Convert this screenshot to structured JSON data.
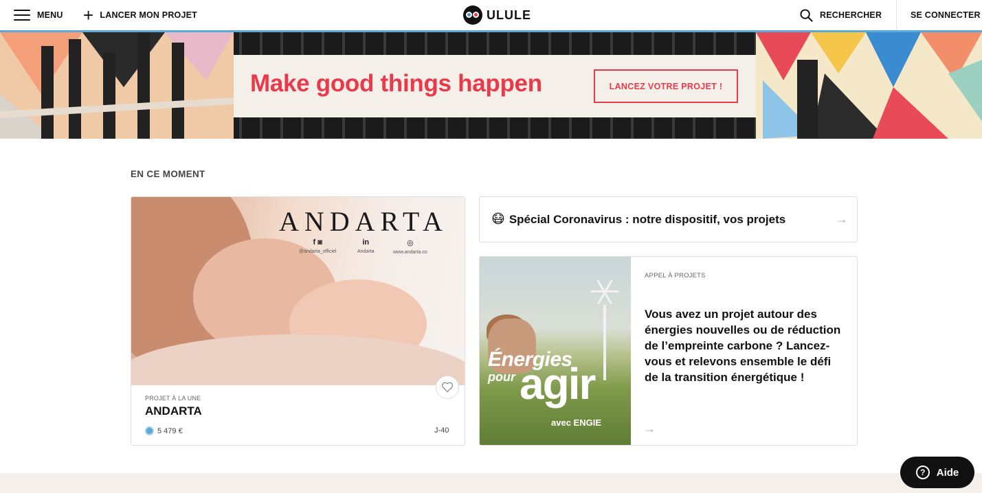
{
  "header": {
    "menu_label": "MENU",
    "launch_label": "LANCER MON PROJET",
    "logo_text": "ULULE",
    "search_label": "RECHERCHER",
    "login_label": "SE CONNECTER"
  },
  "hero": {
    "title": "Make good things happen",
    "cta_label": "LANCEZ VOTRE PROJET !"
  },
  "section": {
    "title": "EN CE MOMENT"
  },
  "featured": {
    "brand_word": "ANDARTA",
    "social": [
      {
        "icon": "f",
        "handle": "@andarta_officiel"
      },
      {
        "icon": "in",
        "handle": "Andarta"
      },
      {
        "icon": "◎",
        "handle": "www.andarta.co"
      }
    ],
    "kicker": "PROJET À LA UNE",
    "name": "ANDARTA",
    "amount": "5 479 €",
    "days_left": "J-40"
  },
  "corona": {
    "emoji": "😷",
    "text": "Spécial Coronavirus : notre dispositif, vos projets"
  },
  "engie": {
    "image_line1": "Énergies",
    "image_line2": "pour",
    "image_line3": "agir",
    "image_line4": "avec ENGIE",
    "kicker": "APPEL À PROJETS",
    "text": "Vous avez un projet autour des énergies nouvelles ou de réduction de l’empreinte carbone ? Lancez-vous et relevons ensemble le défi de la transition énergétique !"
  },
  "help": {
    "label": "Aide"
  },
  "colors": {
    "accent_red": "#e83a4b",
    "accent_blue": "#5aa9d6",
    "hero_box_bg": "#f4efe9"
  }
}
